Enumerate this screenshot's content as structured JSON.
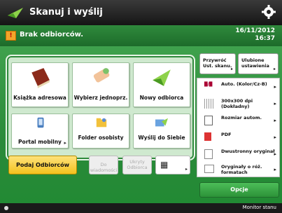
{
  "header": {
    "title": "Skanuj i wyślij"
  },
  "status": {
    "message": "Brak odbiorców.",
    "date": "16/11/2012",
    "time": "16:37"
  },
  "tiles": [
    {
      "label": "Książka adresowa"
    },
    {
      "label": "Wybierz jednoprz."
    },
    {
      "label": "Nowy odbiorca"
    },
    {
      "label": "Portal mobilny"
    },
    {
      "label": "Folder osobisty"
    },
    {
      "label": "Wyślij do Siebie"
    }
  ],
  "bottom_buttons": {
    "recipients": "Podaj Odbiorców",
    "cc": "Do wiadomości",
    "bcc": "Ukryty Odbiorca"
  },
  "right": {
    "recall": "Przywróć Ust. skanu.",
    "favorites": "Ulubione ustawienia"
  },
  "options": [
    {
      "label": "Auto. (Kolor/Cz-B)",
      "icon_text": "█/█"
    },
    {
      "label": "300x300 dpi (Dokładny)",
      "icon_text": "dpi"
    },
    {
      "label": "Rozmiar autom.",
      "icon_text": "size"
    },
    {
      "label": "PDF",
      "icon_text": "PDF"
    },
    {
      "label": "Dwustronny oryginał",
      "icon_text": "dup"
    },
    {
      "label": "Oryginały o róż. formatach",
      "icon_text": "mix"
    }
  ],
  "opcje": "Opcje",
  "footer": {
    "monitor": "Monitor stanu"
  }
}
